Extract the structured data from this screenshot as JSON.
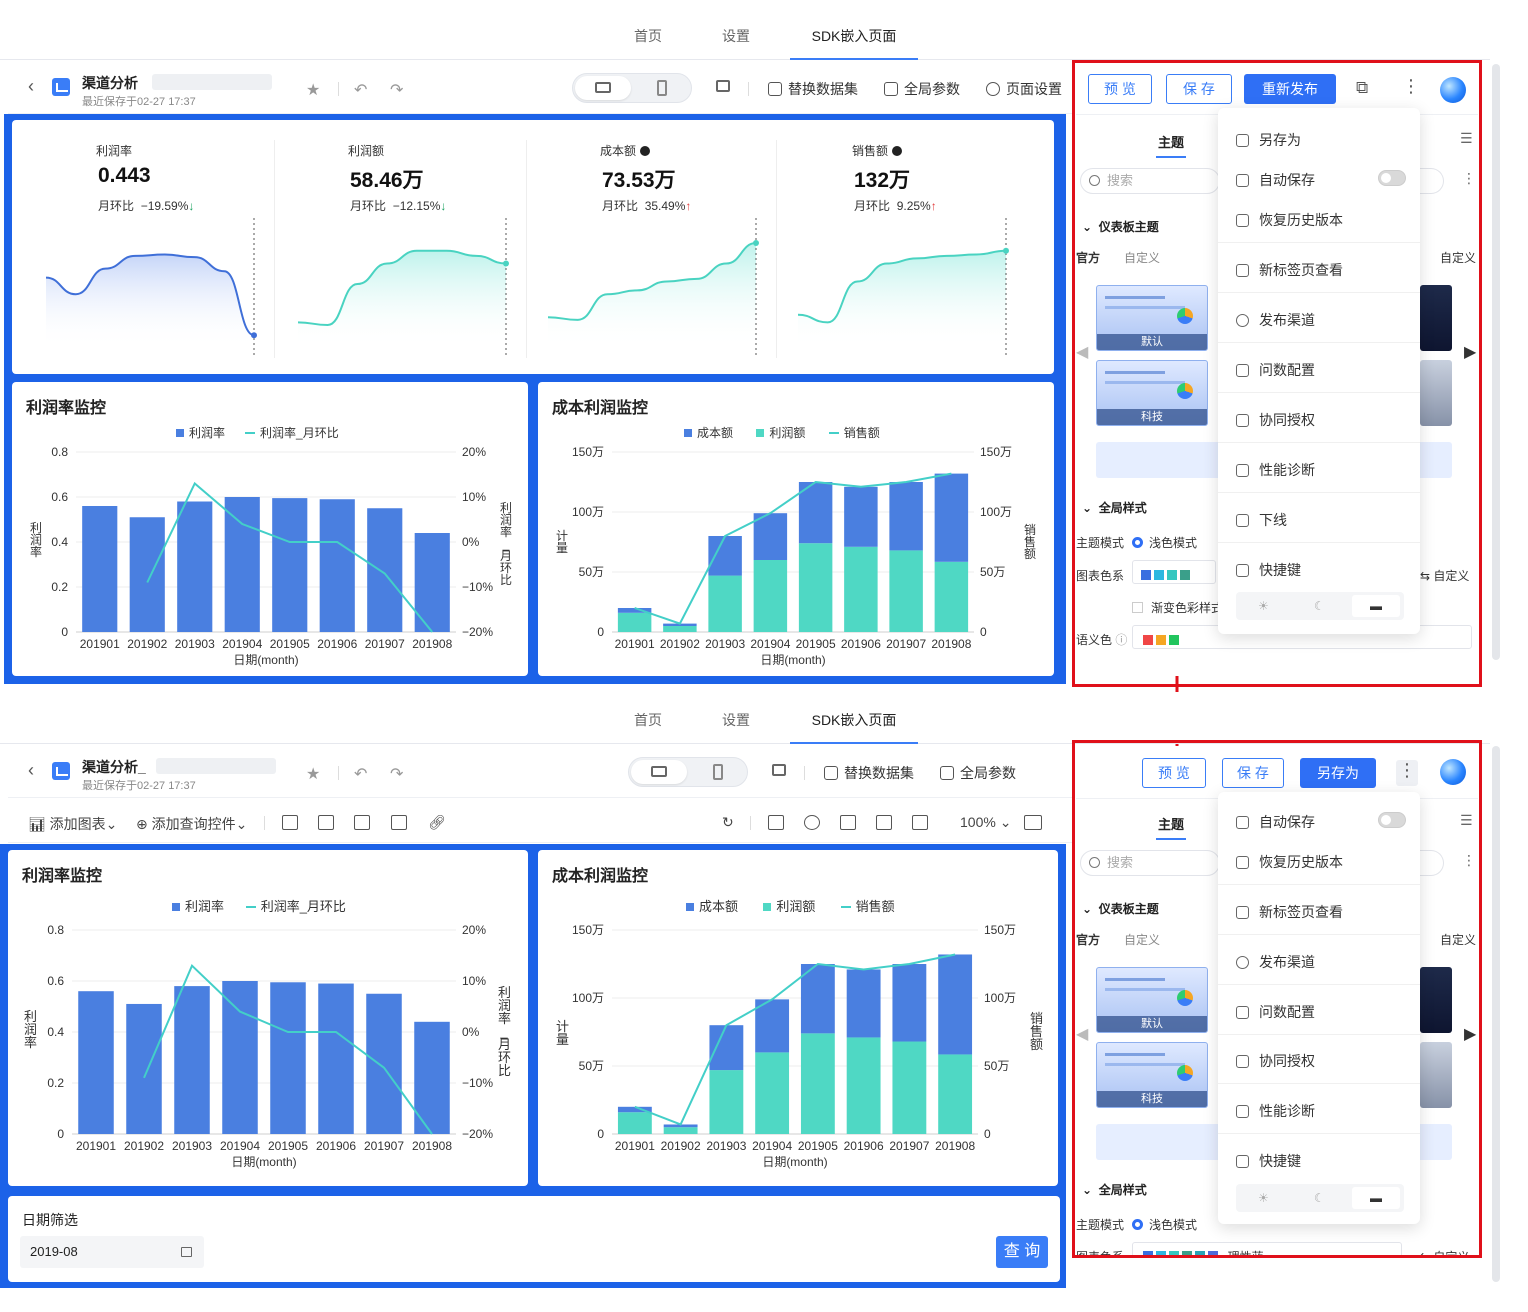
{
  "top": {
    "nav": {
      "tabs": [
        "首页",
        "设置",
        "SDK嵌入页面"
      ],
      "active": "SDK嵌入页面"
    },
    "toolbar": {
      "back_icon": "chevron-left-icon",
      "title": "渠道分析",
      "saved": "最近保存于02-27 17:37",
      "actions": [
        "替换数据集",
        "全局参数",
        "页面设置"
      ]
    },
    "kpis": [
      {
        "label": "利润率",
        "value": "0.443",
        "mom_label": "月环比",
        "mom": "−19.59%",
        "trend": "down",
        "info": false
      },
      {
        "label": "利润额",
        "value": "58.46万",
        "mom_label": "月环比",
        "mom": "−12.15%",
        "trend": "down",
        "info": false
      },
      {
        "label": "成本额",
        "value": "73.53万",
        "mom_label": "月环比",
        "mom": "35.49%",
        "trend": "up",
        "info": true
      },
      {
        "label": "销售额",
        "value": "132万",
        "mom_label": "月环比",
        "mom": "9.25%",
        "trend": "up",
        "info": true
      }
    ],
    "panel": {
      "buttons": {
        "preview": "预 览",
        "save": "保 存",
        "publish": "重新发布"
      },
      "tab": "主题",
      "search_placeholder": "搜索",
      "section_theme": "仪表板主题",
      "subtabs": [
        "官方",
        "自定义"
      ],
      "custom_right": "自定义",
      "thumb1": "默认",
      "thumb2": "科技",
      "section_global": "全局样式",
      "theme_mode_label": "主题模式",
      "theme_mode_value": "浅色模式",
      "palette_label": "图表色系",
      "palette_custom": "自定义",
      "gradient_label": "渐变色彩样式",
      "semantic_label": "语义色"
    },
    "menu": [
      "另存为",
      "自动保存",
      "恢复历史版本",
      "新标签页查看",
      "发布渠道",
      "问数配置",
      "协同授权",
      "性能诊断",
      "下线",
      "快捷键"
    ]
  },
  "bottom": {
    "nav": {
      "tabs": [
        "首页",
        "设置",
        "SDK嵌入页面"
      ],
      "active": "SDK嵌入页面"
    },
    "toolbar": {
      "title": "渠道分析_",
      "saved": "最近保存于02-27 17:37",
      "actions": [
        "替换数据集",
        "全局参数",
        "页面设置"
      ]
    },
    "toolbar2": {
      "add_chart": "添加图表",
      "add_query": "添加查询控件",
      "zoom": "100%"
    },
    "filter": {
      "title": "日期筛选",
      "value": "2019-08",
      "button": "查 询"
    },
    "panel": {
      "buttons": {
        "preview": "预 览",
        "save": "保 存",
        "saveas": "另存为"
      },
      "tab": "主题",
      "search_placeholder": "搜索",
      "section_theme": "仪表板主题",
      "subtabs": [
        "官方",
        "自定义"
      ],
      "custom_right": "自定义",
      "thumb1": "默认",
      "thumb2": "科技",
      "section_global": "全局样式",
      "theme_mode_label": "主题模式",
      "theme_mode_value": "浅色模式",
      "palette_label": "图表色系",
      "palette_value": "理性蓝",
      "palette_custom": "自定义"
    },
    "menu": [
      "自动保存",
      "恢复历史版本",
      "新标签页查看",
      "发布渠道",
      "问数配置",
      "协同授权",
      "性能诊断",
      "快捷键"
    ]
  },
  "colors": {
    "accent": "#2f6ff5",
    "bar_blue": "#4a7fe0",
    "bar_teal": "#4fd8c4",
    "line_teal": "#43cfc8",
    "frame_blue": "#1c62e8",
    "annot_red": "#e0101a"
  },
  "chart_data": [
    {
      "type": "bar",
      "title": "利润率监控",
      "categories": [
        "201901",
        "201902",
        "201903",
        "201904",
        "201905",
        "201906",
        "201907",
        "201908"
      ],
      "series": [
        {
          "name": "利润率",
          "axis": "left",
          "values": [
            0.56,
            0.51,
            0.58,
            0.6,
            0.595,
            0.59,
            0.55,
            0.44
          ]
        },
        {
          "name": "利润率_月环比",
          "type": "line",
          "axis": "right",
          "values": [
            null,
            -9,
            13,
            4,
            0,
            0,
            -7,
            -20
          ]
        }
      ],
      "xlabel": "日期(month)",
      "ylabel": "利润率",
      "y2label": "利润率_月环比",
      "ylim": [
        0,
        0.8
      ],
      "yticks": [
        "0",
        "0.2",
        "0.4",
        "0.6",
        "0.8"
      ],
      "y2lim": [
        -20,
        20
      ],
      "y2ticks": [
        "−20%",
        "−10%",
        "0%",
        "10%",
        "20%"
      ]
    },
    {
      "type": "bar",
      "title": "成本利润监控",
      "stacked": true,
      "categories": [
        "201901",
        "201902",
        "201903",
        "201904",
        "201905",
        "201906",
        "201907",
        "201908"
      ],
      "series": [
        {
          "name": "成本额",
          "values": [
            4,
            2,
            33,
            39,
            51,
            50,
            57,
            73.5
          ]
        },
        {
          "name": "利润额",
          "values": [
            16,
            5,
            47,
            60,
            74,
            71,
            68,
            58.5
          ]
        },
        {
          "name": "销售额",
          "type": "line",
          "axis": "right",
          "values": [
            20,
            7,
            80,
            99,
            125,
            121,
            125,
            132
          ]
        }
      ],
      "xlabel": "日期(month)",
      "ylabel": "计量",
      "y2label": "销售额",
      "ylim": [
        0,
        150
      ],
      "yticks": [
        "0",
        "50万",
        "100万",
        "150万"
      ],
      "y2lim": [
        0,
        150
      ],
      "y2ticks": [
        "0",
        "50万",
        "100万",
        "150万"
      ]
    }
  ],
  "sparklines": [
    {
      "name": "利润率",
      "values": [
        0.55,
        0.42,
        0.62,
        0.72,
        0.73,
        0.71,
        0.6,
        0.1
      ]
    },
    {
      "name": "利润额",
      "values": [
        0.2,
        0.18,
        0.5,
        0.66,
        0.76,
        0.76,
        0.72,
        0.66
      ]
    },
    {
      "name": "成本额",
      "values": [
        0.24,
        0.22,
        0.42,
        0.45,
        0.52,
        0.54,
        0.66,
        0.82
      ]
    },
    {
      "name": "销售额",
      "values": [
        0.26,
        0.2,
        0.52,
        0.66,
        0.7,
        0.72,
        0.73,
        0.76
      ]
    }
  ]
}
